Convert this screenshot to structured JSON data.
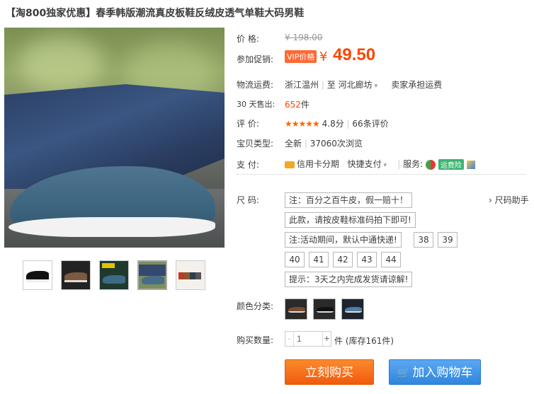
{
  "title": "【淘800独家优惠】春季韩版潮流真皮板鞋反绒皮透气单鞋大码男鞋",
  "price": {
    "label": "价      格:",
    "original": "¥ 198.00"
  },
  "promo": {
    "label": "参加促销:",
    "badge": "VIP价格",
    "currency": "¥",
    "value": "49.50"
  },
  "shipping": {
    "label": "物流运费:",
    "from": "浙江温州",
    "sep": "|",
    "to_prefix": "至",
    "to": "河北廊坊",
    "fee": "卖家承担运费"
  },
  "sales": {
    "label": "30 天售出:",
    "count": "652",
    "unit": "件"
  },
  "rating": {
    "label": "评      价:",
    "stars": "★★★★★",
    "score": "4.8分",
    "sep": "|",
    "reviews": "66条评价"
  },
  "item_type": {
    "label": "宝贝类型:",
    "condition": "全新",
    "sep": "|",
    "views": "37060次浏览"
  },
  "payment": {
    "label": "支      付:",
    "credit": "信用卡分期",
    "quick": "快捷支付",
    "service_label": "服务:",
    "service_badge": "运费险"
  },
  "size": {
    "label": "尺      码:",
    "help": "尺码助手",
    "notes": [
      "注：百分之百牛皮，假一赔十！",
      "此款，请按皮鞋标准码拍下即可!",
      "注:活动期间，默认中通快递!",
      "提示：3天之内完成发货请谅解!"
    ],
    "options": [
      "38",
      "39",
      "40",
      "41",
      "42",
      "43",
      "44"
    ]
  },
  "color": {
    "label": "颜色分类:"
  },
  "quantity": {
    "label": "购买数量:",
    "value": "1",
    "minus": "-",
    "plus": "+",
    "stock": "件 (库存161件)"
  },
  "actions": {
    "buy": "立刻购买",
    "cart": "加入购物车"
  },
  "icons": {
    "dropdown": "chevron-down-icon",
    "cart": "cart-icon"
  }
}
